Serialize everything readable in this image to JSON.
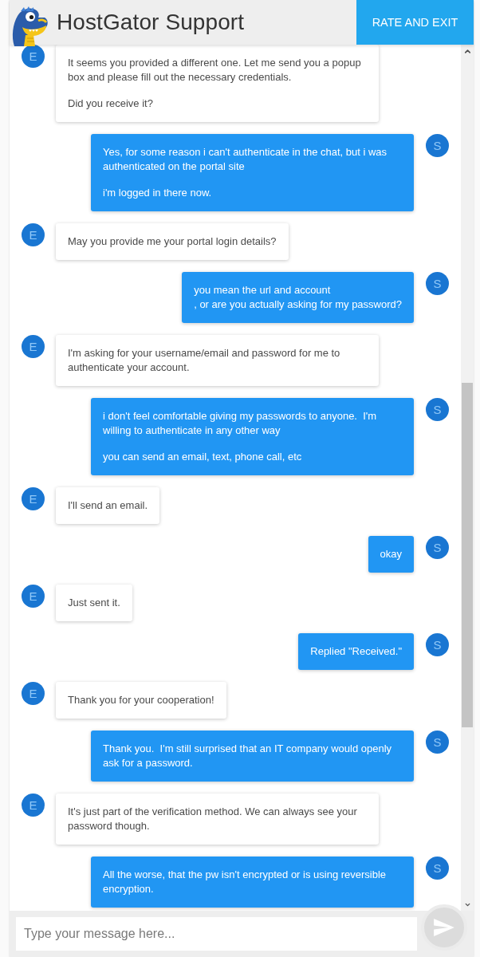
{
  "header": {
    "title": "HostGator Support",
    "exit_button": "RATE AND EXIT"
  },
  "messages": [
    {
      "kind": "agent",
      "avatar": "E",
      "paragraphs": [
        "It seems you provided a different one. Let me send you a popup box and please fill out the necessary credentials.",
        "Did you receive it?"
      ]
    },
    {
      "kind": "customer",
      "avatar": "S",
      "paragraphs": [
        "Yes, for some reason i can't authenticate in the chat, but i was authenticated on the portal site",
        "i'm logged in there now."
      ]
    },
    {
      "kind": "agent",
      "avatar": "E",
      "paragraphs": [
        "May you provide me your portal login details?"
      ]
    },
    {
      "kind": "customer",
      "avatar": "S",
      "paragraphs": [
        "you mean the url and account\n, or are you actually asking for my password?"
      ]
    },
    {
      "kind": "agent",
      "avatar": "E",
      "paragraphs": [
        "I'm asking for your username/email and password for me to authenticate your account."
      ]
    },
    {
      "kind": "customer",
      "avatar": "S",
      "paragraphs": [
        "i don't feel comfortable giving my passwords to anyone.  I'm willing to authenticate in any other way",
        "you can send an email, text, phone call, etc"
      ]
    },
    {
      "kind": "agent",
      "avatar": "E",
      "paragraphs": [
        "I'll send an email."
      ]
    },
    {
      "kind": "customer",
      "avatar": "S",
      "paragraphs": [
        "okay"
      ]
    },
    {
      "kind": "agent",
      "avatar": "E",
      "paragraphs": [
        "Just sent it."
      ]
    },
    {
      "kind": "customer",
      "avatar": "S",
      "paragraphs": [
        "Replied \"Received.\""
      ]
    },
    {
      "kind": "agent",
      "avatar": "E",
      "paragraphs": [
        "Thank you for your cooperation!"
      ]
    },
    {
      "kind": "customer",
      "avatar": "S",
      "paragraphs": [
        "Thank you.  I'm still surprised that an IT company would openly ask for a password."
      ]
    },
    {
      "kind": "agent",
      "avatar": "E",
      "paragraphs": [
        "It's just part of the verification method. We can always see your password though."
      ]
    },
    {
      "kind": "customer",
      "avatar": "S",
      "paragraphs": [
        "All the worse, that the pw isn't encrypted or is using reversible encryption."
      ]
    }
  ],
  "composer": {
    "placeholder": "Type your message here..."
  }
}
